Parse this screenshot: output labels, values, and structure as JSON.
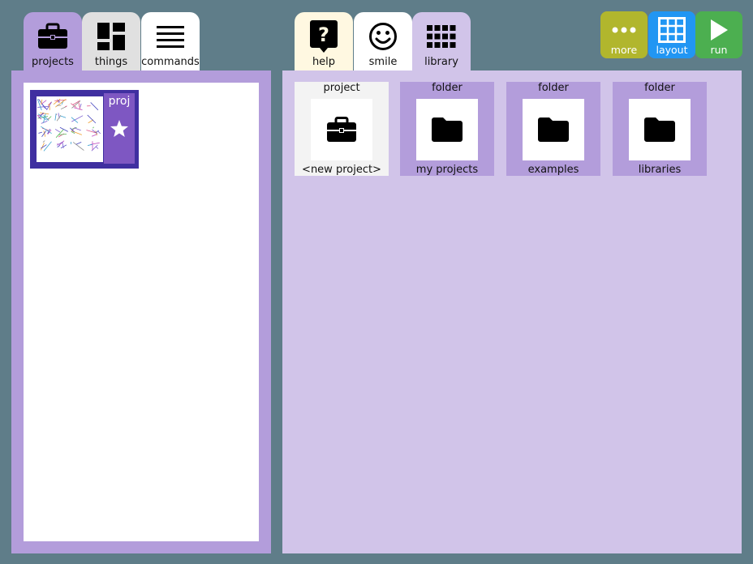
{
  "tabs_left": [
    {
      "label": "projects",
      "icon": "briefcase-icon"
    },
    {
      "label": "things",
      "icon": "dashboard-icon"
    },
    {
      "label": "commands",
      "icon": "list-icon"
    }
  ],
  "tabs_right": [
    {
      "label": "help",
      "icon": "help-bubble-icon"
    },
    {
      "label": "smile",
      "icon": "smiley-icon"
    },
    {
      "label": "library",
      "icon": "grid-icon"
    }
  ],
  "toolbar": {
    "more": "more",
    "layout": "layout",
    "run": "run"
  },
  "project_card": {
    "name": "proj",
    "icon": "star-icon"
  },
  "library_items": [
    {
      "type": "project",
      "caption": "<new project>",
      "icon": "briefcase-icon"
    },
    {
      "type": "folder",
      "caption": "my projects",
      "icon": "folder-icon"
    },
    {
      "type": "folder",
      "caption": "examples",
      "icon": "folder-icon"
    },
    {
      "type": "folder",
      "caption": "libraries",
      "icon": "folder-icon"
    }
  ],
  "colors": {
    "background": "#5f7d89",
    "projects_accent": "#b39ddb",
    "library_panel": "#d1c4e9",
    "more_button": "#b1b62d",
    "layout_button": "#2196f3",
    "run_button": "#4caf50"
  }
}
